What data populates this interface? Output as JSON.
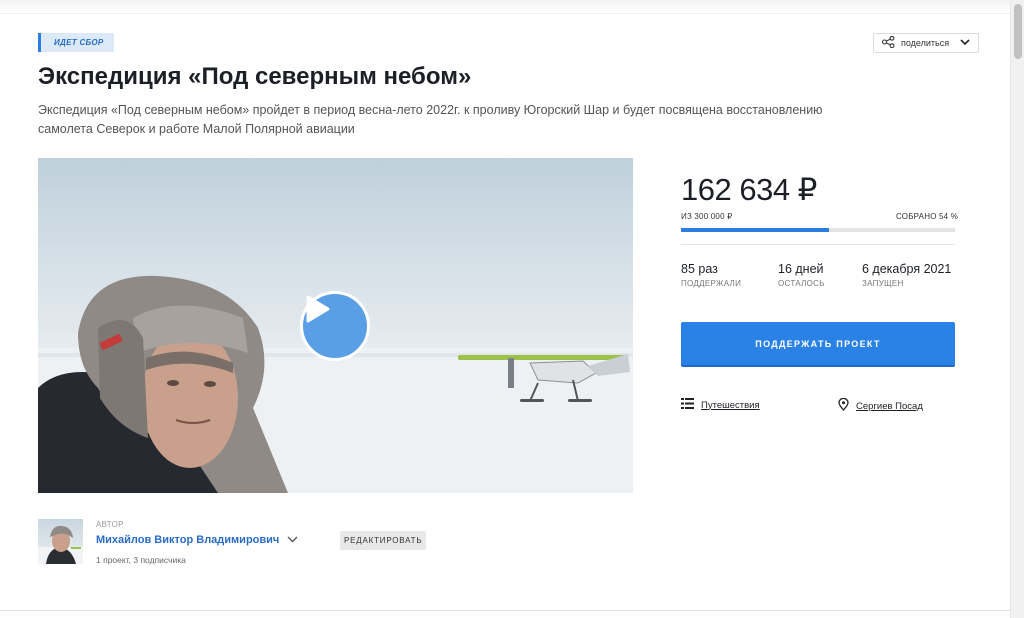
{
  "status_badge": "ИДЕТ СБОР",
  "share": {
    "label": "поделиться"
  },
  "project": {
    "title": "Экспедиция «Под северным небом»",
    "description": "Экспедиция «Под северным небом» пройдет в период весна-лето 2022г. к проливу Югорский Шар и будет посвящена восстановлению самолета Северок и работе Малой Полярной авиации"
  },
  "funding": {
    "amount": "162 634 ₽",
    "goal": "ИЗ 300 000 ₽",
    "collected": "СОБРАНО 54 %",
    "progress_fraction": 0.54
  },
  "stats": [
    {
      "value": "85 раз",
      "label": "ПОДДЕРЖАЛИ"
    },
    {
      "value": "16 дней",
      "label": "ОСТАЛОСЬ"
    },
    {
      "value": "6 декабря 2021",
      "label": "ЗАПУЩЕН"
    }
  ],
  "support_button": "ПОДДЕРЖАТЬ ПРОЕКТ",
  "tags": {
    "category": "Путешествия",
    "location": "Сергиев Посад"
  },
  "author": {
    "caption": "АВТОР",
    "name": "Михайлов Виктор Владимирович",
    "meta": "1 проект, 3 подписчика",
    "edit_label": "РЕДАКТИРОВАТЬ"
  },
  "colors": {
    "accent": "#2b82e6",
    "badge_bg": "#dceaf8",
    "link": "#2a6cc3"
  }
}
